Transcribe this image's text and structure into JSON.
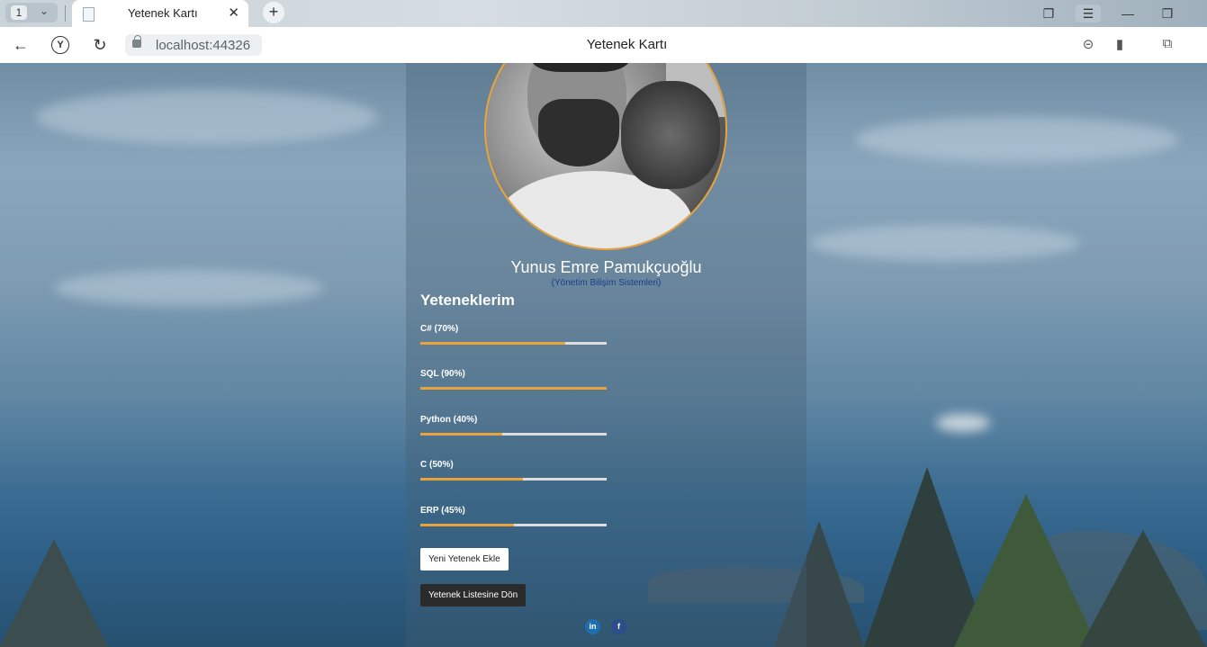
{
  "browser": {
    "tab_count": "1",
    "tab_title": "Yetenek Kartı",
    "url": "localhost:44326",
    "page_title": "Yetenek Kartı",
    "icons": [
      "tab-counter-chevron-icon",
      "page-icon",
      "close-icon",
      "new-tab-icon",
      "collections-icon",
      "menu-icon",
      "minimize-icon",
      "restore-icon",
      "back-icon",
      "yandex-icon",
      "reload-icon",
      "lock-icon",
      "translate-icon",
      "bookmark-icon",
      "extensions-icon"
    ]
  },
  "profile": {
    "name": "Yunus Emre Pamukçuoğlu",
    "department": "(Yönetim Bilişim Sistemleri)"
  },
  "skills_title": "Yeteneklerim",
  "skills": [
    {
      "label": "C# (70%)",
      "percent": 0.78
    },
    {
      "label": "SQL (90%)",
      "percent": 1.0
    },
    {
      "label": "Python (40%)",
      "percent": 0.44
    },
    {
      "label": "C (50%)",
      "percent": 0.55
    },
    {
      "label": "ERP (45%)",
      "percent": 0.5
    }
  ],
  "buttons": {
    "add_skill": "Yeni Yetenek Ekle",
    "back_to_list": "Yetenek Listesine Dön"
  },
  "social": {
    "linkedin": "in",
    "facebook": "f"
  },
  "colors": {
    "accent": "#e8a33d",
    "department_text": "#1c3d8f",
    "dark_button": "#2b2b2b"
  }
}
